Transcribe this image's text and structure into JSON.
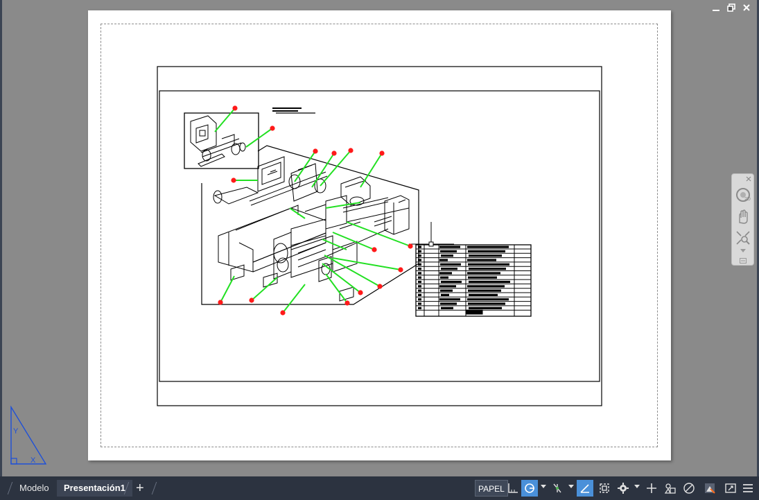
{
  "window": {
    "minimize_icon": "minimize-icon",
    "restore_icon": "restore-icon",
    "close_icon": "close-icon"
  },
  "layout_tabs": [
    {
      "label": "Modelo",
      "active": false
    },
    {
      "label": "Presentación1",
      "active": true
    }
  ],
  "add_tab_label": "+",
  "status": {
    "space_label": "PAPEL",
    "buttons": [
      "grid-snap-icon",
      "dynamic-ucs-icon",
      "isodraft-icon",
      "ortho-icon",
      "selection-cycling-icon",
      "annotation-scale-icon",
      "crosshair-icon",
      "isolate-objects-icon",
      "hardware-accel-icon",
      "annotation-monitor-icon",
      "fullscreen-icon",
      "customize-menu-icon"
    ]
  },
  "navigation_bar": {
    "icons": [
      "steering-wheel-icon",
      "pan-icon",
      "zoom-extents-icon"
    ]
  },
  "ucs_icon": {
    "x_label": "X",
    "y_label": "Y"
  },
  "colors": {
    "viewport_bg": "#8a8a8a",
    "status_bg": "#2c3340",
    "accent": "#4a90d9",
    "leader_green": "#22e022",
    "balloon_red": "#ff1a1a"
  }
}
